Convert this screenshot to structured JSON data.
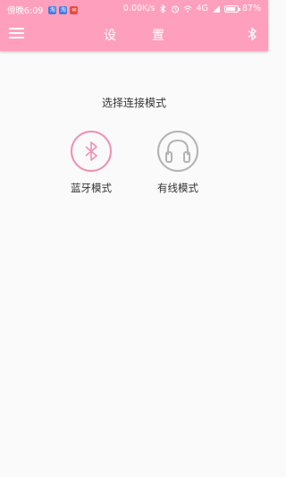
{
  "status_bar": {
    "time": "傍晚6:09",
    "notifications": [
      {
        "icon": "app-notification-icon",
        "glyph": "淘",
        "color": "#3f7de0"
      },
      {
        "icon": "app-notification-icon",
        "glyph": "淘",
        "color": "#3f7de0"
      },
      {
        "icon": "message-notification-icon",
        "glyph": "✉",
        "color": "#e94a3c"
      }
    ],
    "network_speed": "0.00K/s",
    "network_type": "4G",
    "battery": "87%",
    "battery_level": 0.87,
    "icons": [
      "bluetooth-icon",
      "alarm-icon",
      "wifi-icon",
      "signal-icon",
      "battery-icon"
    ]
  },
  "toolbar": {
    "title": "设置",
    "menu_icon": "hamburger-menu-icon",
    "right_icon": "bluetooth-icon",
    "color": "#ff9fbe"
  },
  "main": {
    "prompt": "选择连接模式",
    "options": [
      {
        "label": "蓝牙模式",
        "icon": "bluetooth-icon",
        "color": "#f28fb2"
      },
      {
        "label": "有线模式",
        "icon": "headphones-icon",
        "color": "#b3b3b3"
      }
    ]
  }
}
